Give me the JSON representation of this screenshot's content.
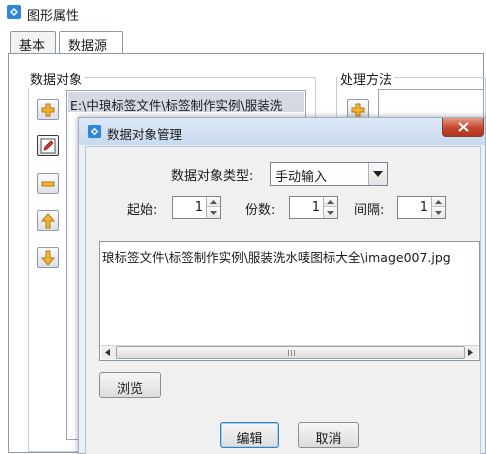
{
  "window": {
    "title": "图形属性"
  },
  "tabs": [
    {
      "label": "基本",
      "active": false
    },
    {
      "label": "数据源",
      "active": true
    }
  ],
  "data_objects": {
    "label": "数据对象",
    "items": [
      "E:\\中琅标签文件\\标签制作实例\\服装洗"
    ],
    "buttons": [
      {
        "name": "add",
        "icon": "plus-icon"
      },
      {
        "name": "edit",
        "icon": "pencil-icon"
      },
      {
        "name": "remove",
        "icon": "minus-icon"
      },
      {
        "name": "move-up",
        "icon": "arrow-up-icon"
      },
      {
        "name": "move-down",
        "icon": "arrow-down-icon"
      }
    ]
  },
  "processing": {
    "label": "处理方法"
  },
  "dialog": {
    "title": "数据对象管理",
    "type_label": "数据对象类型:",
    "type_value": "手动输入",
    "start_label": "起始:",
    "start_value": "1",
    "copies_label": "份数:",
    "copies_value": "1",
    "interval_label": "间隔:",
    "interval_value": "1",
    "content": "琅标签文件\\标签制作实例\\服装洗水唛图标大全\\image007.jpg",
    "browse_label": "浏览",
    "edit_label": "编辑",
    "cancel_label": "取消"
  },
  "colors": {
    "accent_blue": "#3c7fb1",
    "icon_yellow": "#f4b632",
    "close_red": "#c4472e",
    "list_selection": "#d4d9e2"
  }
}
